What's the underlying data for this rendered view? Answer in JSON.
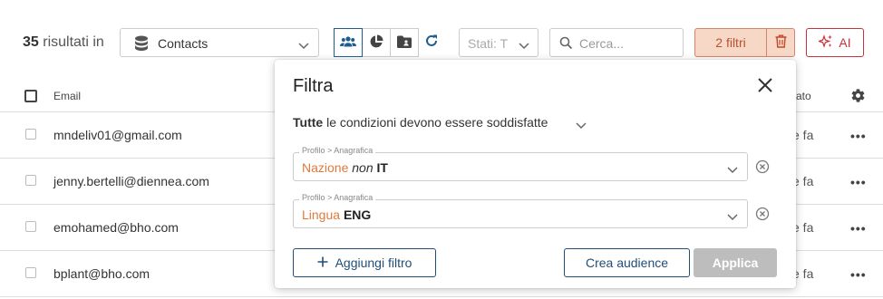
{
  "toolbar": {
    "count": "35",
    "count_suffix": "risultati in",
    "source": "Contacts",
    "stati_placeholder": "Stati: T",
    "search_placeholder": "Cerca...",
    "filters_label": "2 filtri",
    "ai_label": "AI"
  },
  "table": {
    "col_email": "Email",
    "col_modified": "ficato",
    "rows": [
      {
        "email": "mndeliv01@gmail.com",
        "modified": "e fa"
      },
      {
        "email": "jenny.bertelli@diennea.com",
        "modified": "e fa"
      },
      {
        "email": "emohamed@bho.com",
        "modified": "e fa"
      },
      {
        "email": "bplant@bho.com",
        "modified": "e fa"
      }
    ],
    "row_menu": "•••"
  },
  "modal": {
    "title": "Filtra",
    "condition_strong": "Tutte",
    "condition_rest": "le condizioni devono essere soddisfatte",
    "filters": [
      {
        "legend": "Profilo > Anagrafica",
        "field": "Nazione",
        "operator": "non",
        "value": "IT"
      },
      {
        "legend": "Profilo > Anagrafica",
        "field": "Lingua",
        "operator": "",
        "value": "ENG"
      }
    ],
    "add_label": "Aggiungi filtro",
    "create_label": "Crea audience",
    "apply_label": "Applica"
  },
  "colors": {
    "accent_blue": "#1f4e79",
    "filter_orange": "#e07a3c",
    "filters_bg": "#f7d8c7",
    "ai_red": "#c8333a"
  }
}
